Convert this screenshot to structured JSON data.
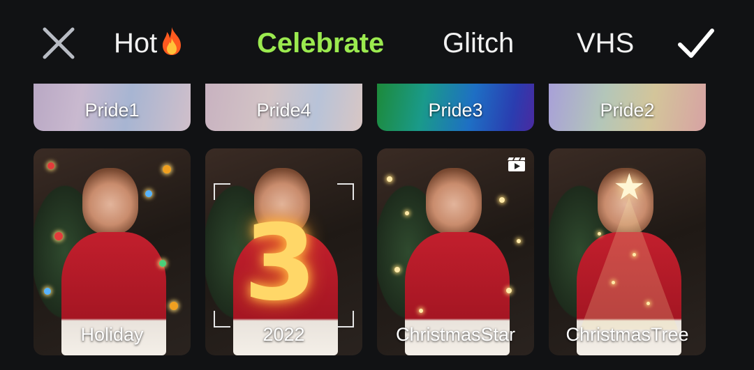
{
  "topbar": {
    "tabs": [
      {
        "label": "Hot",
        "emoji": "fire-icon"
      },
      {
        "label": "Celebrate",
        "active": true
      },
      {
        "label": "Glitch"
      },
      {
        "label": "VHS"
      }
    ],
    "close_icon": "close-icon",
    "confirm_icon": "check-icon",
    "active_color": "#9bea4f"
  },
  "effects_row1": [
    {
      "label": "Pride1"
    },
    {
      "label": "Pride4"
    },
    {
      "label": "Pride3"
    },
    {
      "label": "Pride2"
    }
  ],
  "effects_row2": [
    {
      "label": "Holiday"
    },
    {
      "label": "2022",
      "overlay": "3"
    },
    {
      "label": "ChristmasStar",
      "badge": "video-icon"
    },
    {
      "label": "ChristmasTree"
    }
  ]
}
